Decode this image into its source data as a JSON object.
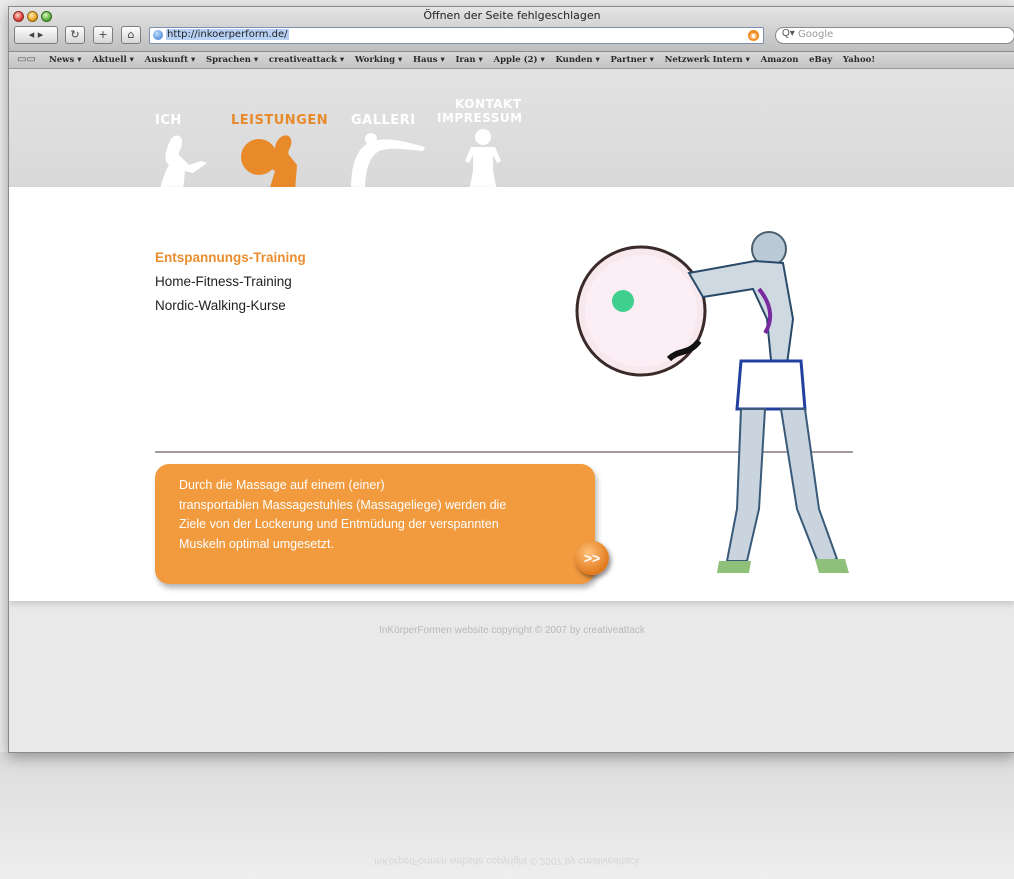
{
  "window": {
    "title": "Öffnen der Seite fehlgeschlagen",
    "url": "http://inkoerperform.de/",
    "search_placeholder": "Google"
  },
  "bookmarks": [
    "News ▾",
    "Aktuell ▾",
    "Auskunft ▾",
    "Sprachen ▾",
    "creativeattack ▾",
    "Working ▾",
    "Haus ▾",
    "Iran ▾",
    "Apple (2) ▾",
    "Kunden ▾",
    "Partner ▾",
    "Netzwerk Intern ▾",
    "Amazon",
    "eBay",
    "Yahoo!"
  ],
  "nav": {
    "ich": "ICH",
    "leistungen": "LEISTUNGEN",
    "galleri": "GALLERI",
    "kontakt": "KONTAKT",
    "impressum": "IMPRESSUM"
  },
  "menu": {
    "item1": "Entspannungs-Training",
    "item2": "Home-Fitness-Training",
    "item3": "Nordic-Walking-Kurse"
  },
  "info": {
    "text": "Durch die Massage auf einem (einer)\ntransportablen Massagestuhles (Massageliege) werden die\nZiele von der Lockerung und Entmüdung der verspannten\nMuskeln optimal umgesetzt.",
    "more_label": ">>"
  },
  "footer": "InKörperFormen website copyright © 2007 by creativeattack",
  "colors": {
    "accent": "#ea8d2e",
    "box": "#f19a3e",
    "divider": "#a59aa3"
  }
}
